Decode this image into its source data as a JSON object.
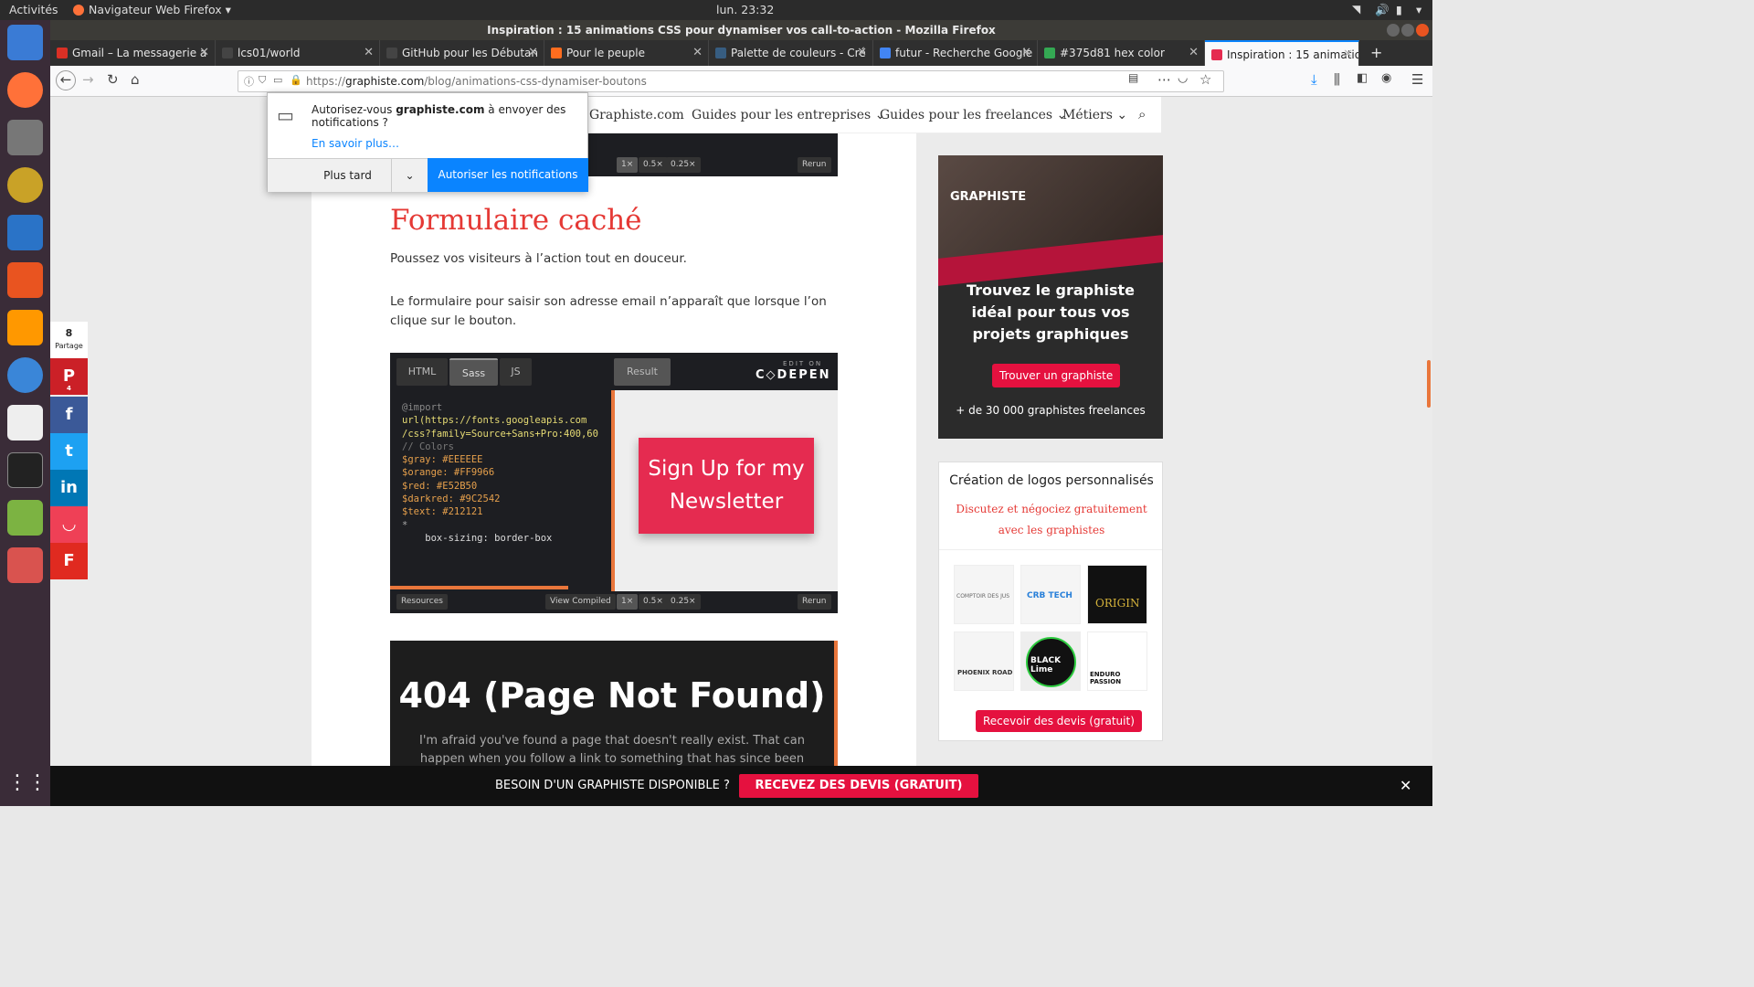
{
  "system": {
    "activities": "Activités",
    "app_menu": "Navigateur Web Firefox ▾",
    "clock": "lun. 23:32"
  },
  "window": {
    "title": "Inspiration : 15 animations CSS pour dynamiser vos call-to-action - Mozilla Firefox"
  },
  "tabs": [
    {
      "label": "Gmail – La messagerie a",
      "color": "#d93025"
    },
    {
      "label": "lcs01/world",
      "color": "#444"
    },
    {
      "label": "GitHub pour les Débutan",
      "color": "#444"
    },
    {
      "label": "Pour le peuple",
      "color": "#ff6d1f"
    },
    {
      "label": "Palette de couleurs - Cré",
      "color": "#375d81"
    },
    {
      "label": "futur - Recherche Google",
      "color": "#4285f4"
    },
    {
      "label": "#375d81 hex color",
      "color": "#34a853"
    },
    {
      "label": "Inspiration : 15 animatio",
      "color": "#e52b50"
    }
  ],
  "url": {
    "prefix": "https://",
    "domain": "graphiste.com",
    "path": "/blog/animations-css-dynamiser-boutons"
  },
  "site_nav": {
    "brand": "Graphiste.com",
    "items": [
      "Guides pour les entreprises ⌄",
      "Guides pour les freelances ⌄",
      "Métiers ⌄"
    ]
  },
  "popup": {
    "text_a": "Autorisez-vous ",
    "domain": "graphiste.com",
    "text_b": " à envoyer des notifications ?",
    "learn_more": "En savoir plus…",
    "later": "Plus tard",
    "allow": "Autoriser les notifications"
  },
  "share": {
    "count": "8",
    "label": "Partage",
    "pinterest_count": "4"
  },
  "article": {
    "heading": "Formulaire caché",
    "p1": "Poussez vos visiteurs à l’action tout en douceur.",
    "p2": "Le formulaire pour saisir son adresse email n’apparaît que lorsque l’on clique sur le bouton."
  },
  "codepen_top": {
    "zoom": [
      "1×",
      "0.5×",
      "0.25×"
    ],
    "rerun": "Rerun"
  },
  "codepen": {
    "tabs": [
      "HTML",
      "Sass",
      "JS"
    ],
    "result": "Result",
    "edit_on": "EDIT ON",
    "brand": "C◇DEPEN",
    "code": [
      {
        "t": "@import",
        "c": "#888"
      },
      {
        "t": "url(https://fonts.googleapis.com",
        "c": "#e6db74"
      },
      {
        "t": "/css?family=Source+Sans+Pro:400,60",
        "c": "#e6db74"
      },
      {
        "t": "",
        "c": "#888"
      },
      {
        "t": "// Colors",
        "c": "#777"
      },
      {
        "t": "$gray: #EEEEEE",
        "c": "#e6a04c"
      },
      {
        "t": "$orange: #FF9966",
        "c": "#e6a04c"
      },
      {
        "t": "$red: #E52B50",
        "c": "#e6a04c"
      },
      {
        "t": "$darkred: #9C2542",
        "c": "#e6a04c"
      },
      {
        "t": "$text: #212121",
        "c": "#e6a04c"
      },
      {
        "t": "",
        "c": "#888"
      },
      {
        "t": "*",
        "c": "#aaa"
      },
      {
        "t": "    box-sizing: border-box",
        "c": "#ddd"
      }
    ],
    "signup": "Sign Up for my Newsletter",
    "resources": "Resources",
    "view_compiled": "View Compiled",
    "zoom": [
      "1×",
      "0.5×",
      "0.25×"
    ],
    "rerun": "Rerun"
  },
  "demo404": {
    "title": "404 (Page Not Found)",
    "text": "I'm afraid you've found a page that doesn't really exist. That can happen when you follow a link to something that has since been deleted. Or the link"
  },
  "ad": {
    "brand": "GRAPHISTE",
    "headline": "Trouvez le graphiste idéal pour tous vos projets graphiques",
    "cta": "Trouver un graphiste",
    "sub": "+ de 30 000 graphistes freelances"
  },
  "logos_box": {
    "title": "Création de logos personnalisés",
    "sub": "Discutez et négociez gratuitement avec les graphistes",
    "logos": [
      "COMPTOIR DES JUS",
      "CRB TECH",
      "ORIGIN",
      "PHOENIX ROAD",
      "BLACK Lime",
      "ENDURO PASSION"
    ],
    "cta": "Recevoir des devis (gratuit)"
  },
  "footer": {
    "text": "BESOIN D'UN GRAPHISTE DISPONIBLE ?",
    "cta": "RECEVEZ DES DEVIS (GRATUIT)"
  }
}
